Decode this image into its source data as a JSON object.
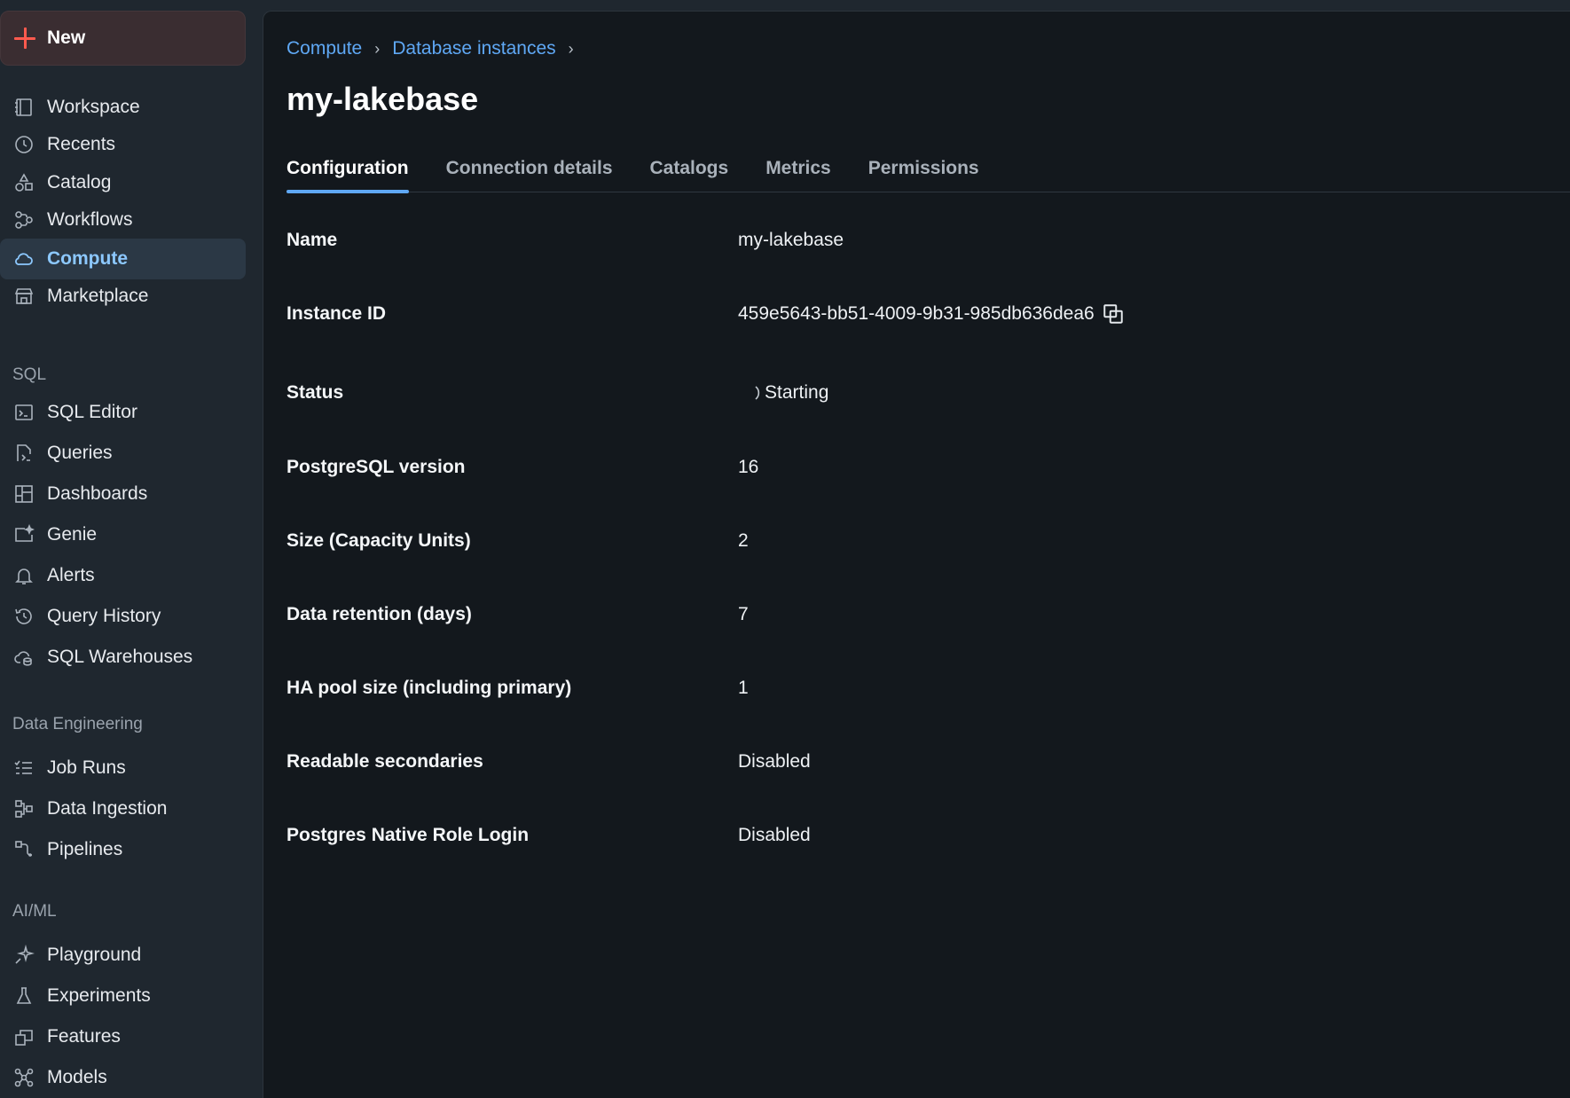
{
  "sidebar": {
    "new_label": "New",
    "primary": [
      {
        "label": "Workspace",
        "icon": "workspace-icon"
      },
      {
        "label": "Recents",
        "icon": "clock-icon"
      },
      {
        "label": "Catalog",
        "icon": "catalog-icon"
      },
      {
        "label": "Workflows",
        "icon": "workflows-icon"
      },
      {
        "label": "Compute",
        "icon": "cloud-icon",
        "active": true
      },
      {
        "label": "Marketplace",
        "icon": "store-icon"
      }
    ],
    "sql_title": "SQL",
    "sql": [
      {
        "label": "SQL Editor",
        "icon": "sql-editor-icon"
      },
      {
        "label": "Queries",
        "icon": "query-file-icon"
      },
      {
        "label": "Dashboards",
        "icon": "dashboard-icon"
      },
      {
        "label": "Genie",
        "icon": "genie-icon"
      },
      {
        "label": "Alerts",
        "icon": "bell-icon"
      },
      {
        "label": "Query History",
        "icon": "history-icon"
      },
      {
        "label": "SQL Warehouses",
        "icon": "warehouse-icon"
      }
    ],
    "de_title": "Data Engineering",
    "de": [
      {
        "label": "Job Runs",
        "icon": "list-check-icon"
      },
      {
        "label": "Data Ingestion",
        "icon": "ingestion-icon"
      },
      {
        "label": "Pipelines",
        "icon": "pipeline-icon"
      }
    ],
    "ml_title": "AI/ML",
    "ml": [
      {
        "label": "Playground",
        "icon": "sparkle-icon"
      },
      {
        "label": "Experiments",
        "icon": "flask-icon"
      },
      {
        "label": "Features",
        "icon": "features-icon"
      },
      {
        "label": "Models",
        "icon": "models-icon"
      }
    ]
  },
  "breadcrumb": [
    "Compute",
    "Database instances"
  ],
  "title": "my-lakebase",
  "tabs": [
    "Configuration",
    "Connection details",
    "Catalogs",
    "Metrics",
    "Permissions"
  ],
  "config": [
    {
      "key": "Name",
      "value": "my-lakebase"
    },
    {
      "key": "Instance ID",
      "value": "459e5643-bb51-4009-9b31-985db636dea6"
    },
    {
      "key": "Status",
      "value": "Starting"
    },
    {
      "key": "PostgreSQL version",
      "value": "16"
    },
    {
      "key": "Size (Capacity Units)",
      "value": "2"
    },
    {
      "key": "Data retention (days)",
      "value": "7"
    },
    {
      "key": "HA pool size (including primary)",
      "value": "1"
    },
    {
      "key": "Readable secondaries",
      "value": "Disabled"
    },
    {
      "key": "Postgres Native Role Login",
      "value": "Disabled"
    }
  ],
  "colors": {
    "accent": "#5fa8f5",
    "new_plus": "#ff5a4e",
    "active_nav": "#8cc8ff"
  }
}
